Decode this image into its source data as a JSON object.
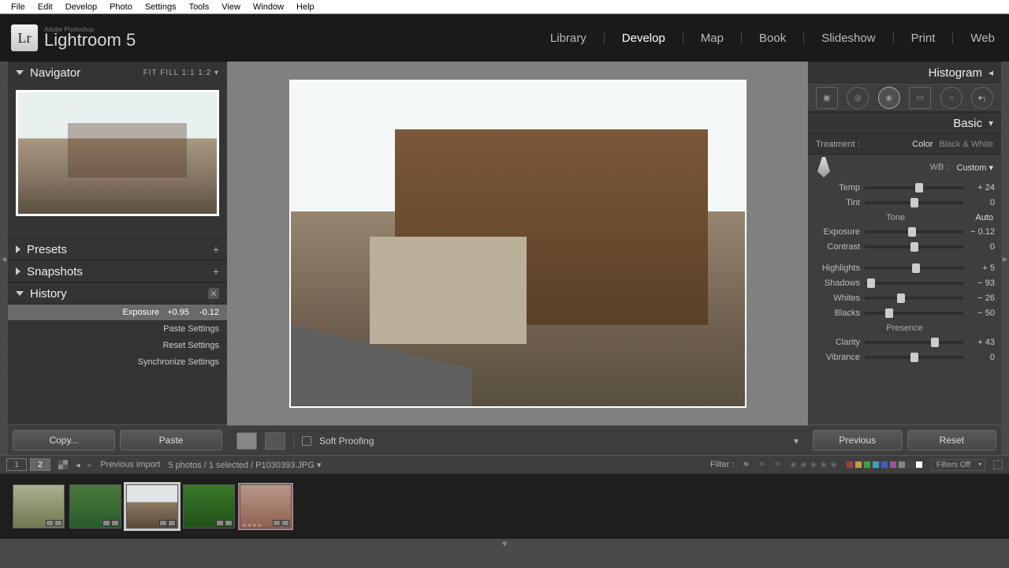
{
  "menubar": [
    "File",
    "Edit",
    "Develop",
    "Photo",
    "Settings",
    "Tools",
    "View",
    "Window",
    "Help"
  ],
  "app": {
    "suite": "Adobe Photoshop",
    "name": "Lightroom 5",
    "logo": "Lr"
  },
  "modules": [
    {
      "label": "Library",
      "active": false
    },
    {
      "label": "Develop",
      "active": true
    },
    {
      "label": "Map",
      "active": false
    },
    {
      "label": "Book",
      "active": false
    },
    {
      "label": "Slideshow",
      "active": false
    },
    {
      "label": "Print",
      "active": false
    },
    {
      "label": "Web",
      "active": false
    }
  ],
  "left": {
    "navigator": {
      "title": "Navigator",
      "opts": "FIT   FILL   1:1   1:2 ▾"
    },
    "presets": {
      "title": "Presets"
    },
    "snapshots": {
      "title": "Snapshots"
    },
    "history": {
      "title": "History",
      "items": [
        {
          "label": "Exposure",
          "a": "+0.95",
          "b": "-0.12",
          "sel": true
        },
        {
          "label": "Paste Settings",
          "a": "",
          "b": ""
        },
        {
          "label": "Reset Settings",
          "a": "",
          "b": ""
        },
        {
          "label": "Synchronize Settings",
          "a": "",
          "b": ""
        }
      ]
    },
    "foot": {
      "copy": "Copy...",
      "paste": "Paste"
    }
  },
  "center": {
    "soft_proof": "Soft Proofing"
  },
  "right": {
    "histogram": "Histogram",
    "basic": "Basic",
    "treatment": {
      "label": "Treatment :",
      "color": "Color",
      "bw": "Black & White"
    },
    "wb": {
      "label": "WB :",
      "value": "Custom ▾"
    },
    "temp": {
      "label": "Temp",
      "val": "+ 24",
      "pos": 55
    },
    "tint": {
      "label": "Tint",
      "val": "0",
      "pos": 50
    },
    "tone": {
      "head": "Tone",
      "auto": "Auto"
    },
    "exposure": {
      "label": "Exposure",
      "val": "− 0.12",
      "pos": 48
    },
    "contrast": {
      "label": "Contrast",
      "val": "0",
      "pos": 50
    },
    "highlights": {
      "label": "Highlights",
      "val": "+ 5",
      "pos": 52
    },
    "shadows": {
      "label": "Shadows",
      "val": "− 93",
      "pos": 6
    },
    "whites": {
      "label": "Whites",
      "val": "− 26",
      "pos": 37
    },
    "blacks": {
      "label": "Blacks",
      "val": "− 50",
      "pos": 25
    },
    "presence": "Presence",
    "clarity": {
      "label": "Clarity",
      "val": "+ 43",
      "pos": 71
    },
    "vibrance": {
      "label": "Vibrance",
      "val": "0",
      "pos": 50
    },
    "foot": {
      "prev": "Previous",
      "reset": "Reset"
    }
  },
  "strip": {
    "pages": [
      "1",
      "2"
    ],
    "info": "Previous import",
    "count": "5 photos / 1 selected / P1030393.JPG ▾",
    "filter_label": "Filter :",
    "dropdown": "Filters Off",
    "swatches": [
      "#a04040",
      "#c0a040",
      "#40a040",
      "#40a0c0",
      "#4060c0",
      "#a050a0",
      "#888",
      "#444",
      "#fff"
    ]
  }
}
